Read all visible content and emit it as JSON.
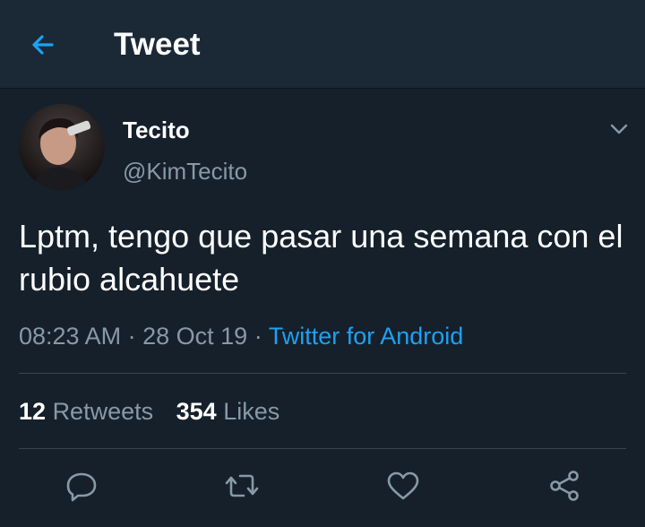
{
  "header": {
    "title": "Tweet",
    "back_icon": "arrow-left-icon",
    "accent_color": "#1da1f2"
  },
  "author": {
    "display_name": "Tecito",
    "handle": "@KimTecito",
    "avatar_icon": "profile-photo"
  },
  "tweet": {
    "text": "Lptm, tengo que pasar una semana con el rubio alcahuete",
    "time": "08:23 AM",
    "date": "28 Oct 19",
    "separator": "·",
    "source": "Twitter for Android"
  },
  "stats": {
    "retweets_count": "12",
    "retweets_label": "Retweets",
    "likes_count": "354",
    "likes_label": "Likes"
  },
  "actions": [
    {
      "icon": "reply-icon"
    },
    {
      "icon": "retweet-icon"
    },
    {
      "icon": "heart-icon"
    },
    {
      "icon": "share-icon"
    }
  ],
  "colors": {
    "background": "#15202b",
    "header_background": "#1b2836",
    "secondary_text": "#8899a6",
    "divider": "#38444d"
  }
}
